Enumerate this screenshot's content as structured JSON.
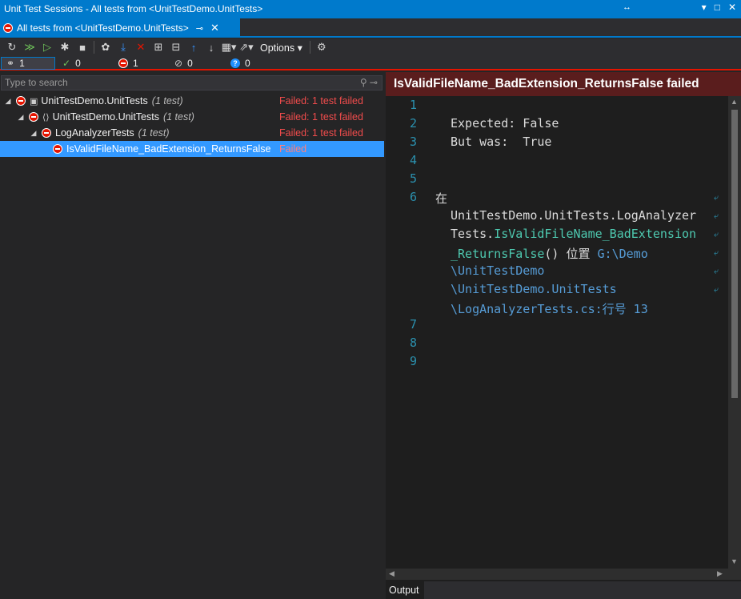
{
  "window": {
    "title": "Unit Test Sessions - All tests from <UnitTestDemo.UnitTests>",
    "resize_glyph": "↔",
    "controls": [
      "▾",
      "□",
      "✕"
    ]
  },
  "tab": {
    "label": "All tests from <UnitTestDemo.UnitTests>",
    "pin": "⊸",
    "close": "✕"
  },
  "toolbar": {
    "options_label": "Options",
    "icons": [
      "refresh-icon",
      "run-all-icon",
      "run-icon",
      "debug-icon",
      "stop-icon",
      "track-icon",
      "import-icon",
      "remove-icon",
      "add-icon",
      "collapse-icon",
      "up-icon",
      "down-icon",
      "group-icon",
      "export-icon",
      "settings-icon"
    ]
  },
  "stats": {
    "total": "1",
    "passed": "0",
    "failed": "1",
    "ignored": "0",
    "inconclusive": "0"
  },
  "search": {
    "placeholder": "Type to search"
  },
  "tree": [
    {
      "name": "UnitTestDemo.UnitTests",
      "count": "(1 test)",
      "status": "Failed: 1 test failed"
    },
    {
      "name": "UnitTestDemo.UnitTests",
      "count": "(1 test)",
      "status": "Failed: 1 test failed"
    },
    {
      "name": "LogAnalyzerTests",
      "count": "(1 test)",
      "status": "Failed: 1 test failed"
    },
    {
      "name": "IsValidFileName_BadExtension_ReturnsFalse",
      "count": "",
      "status": "Failed"
    }
  ],
  "details": {
    "header": "IsValidFileName_BadExtension_ReturnsFalse failed",
    "line_numbers": [
      "1",
      "2",
      "3",
      "4",
      "5",
      "6",
      "7",
      "8",
      "9"
    ],
    "expected_line": "Expected: False",
    "but_was_line": "But was:  True",
    "at_label": "在",
    "stack1": "UnitTestDemo.UnitTests.LogAnalyzer",
    "stack2a": "Tests.",
    "stack2b": "IsValidFileName_BadExtension",
    "stack3a": "_ReturnsFalse",
    "stack3b": "() 位置 ",
    "stack3c": "G:\\Demo",
    "stack4": "\\UnitTestDemo",
    "stack5": "\\UnitTestDemo.UnitTests",
    "stack6": "\\LogAnalyzerTests.cs:行号 13"
  },
  "output": {
    "tab_label": "Output"
  },
  "colors": {
    "accent": "#007acc",
    "fail": "#e51400",
    "selection": "#3399ff"
  }
}
